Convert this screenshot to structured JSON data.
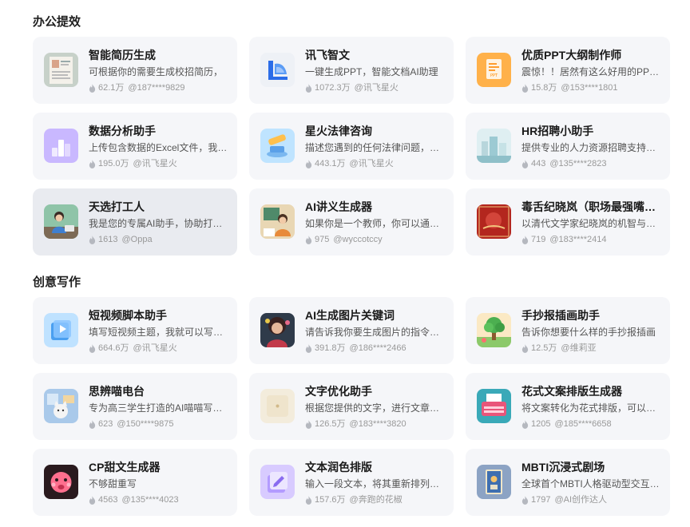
{
  "sections": [
    {
      "title": "办公提效",
      "cards": [
        {
          "name": "智能简历生成",
          "desc": "可根据你的需要生成校招简历，",
          "count": "62.1万",
          "author": "@187****9829",
          "icon": "resume-icon"
        },
        {
          "name": "讯飞智文",
          "desc": "一键生成PPT，智能文档AI助理",
          "count": "1072.3万",
          "author": "@讯飞星火",
          "icon": "zhiwen-logo-icon"
        },
        {
          "name": "优质PPT大纲制作师",
          "desc": "震惊！！居然有这么好用的PPT大纲制作师",
          "count": "15.8万",
          "author": "@153****1801",
          "icon": "ppt-icon"
        },
        {
          "name": "数据分析助手",
          "desc": "上传包含数据的Excel文件，我来帮你分析",
          "count": "195.0万",
          "author": "@讯飞星火",
          "icon": "bar-chart-icon"
        },
        {
          "name": "星火法律咨询",
          "desc": "描述您遇到的任何法律问题，我来解答",
          "count": "443.1万",
          "author": "@讯飞星火",
          "icon": "gavel-icon"
        },
        {
          "name": "HR招聘小助手",
          "desc": "提供专业的人力资源招聘支持与建议",
          "count": "443",
          "author": "@135****2823",
          "icon": "city-icon"
        },
        {
          "name": "天选打工人",
          "desc": "我是您的专属AI助手，协助打工人办公",
          "count": "1613",
          "author": "@Oppa",
          "icon": "worker-avatar-icon"
        },
        {
          "name": "AI讲义生成器",
          "desc": "如果你是一个教师，你可以通过我生成讲义",
          "count": "975",
          "author": "@wyccotccy",
          "icon": "teacher-avatar-icon"
        },
        {
          "name": "毒舌纪晓岚（职场最强嘴替）",
          "desc": "以清代文学家纪晓岚的机智与毒舌回复",
          "count": "719",
          "author": "@183****2414",
          "icon": "jixiaolan-icon"
        }
      ]
    },
    {
      "title": "创意写作",
      "cards": [
        {
          "name": "短视频脚本助手",
          "desc": "填写短视频主题，我就可以写出脚本",
          "count": "664.6万",
          "author": "@讯飞星火",
          "icon": "video-script-icon"
        },
        {
          "name": "AI生成图片关键词",
          "desc": "请告诉我你要生成图片的指令，我来优化",
          "count": "391.8万",
          "author": "@186****2466",
          "icon": "portrait-icon"
        },
        {
          "name": "手抄报插画助手",
          "desc": "告诉你想要什么样的手抄报插画",
          "count": "12.5万",
          "author": "@维莉亚",
          "icon": "tree-illustration-icon"
        },
        {
          "name": "思辨喵电台",
          "desc": "专为高三学生打造的AI喵喵写作电台",
          "count": "623",
          "author": "@150****9875",
          "icon": "cat-radio-icon"
        },
        {
          "name": "文字优化助手",
          "desc": "根据您提供的文字，进行文章优化润色",
          "count": "126.5万",
          "author": "@183****3820",
          "icon": "document-icon"
        },
        {
          "name": "花式文案排版生成器",
          "desc": "将文案转化为花式排版，可以直接使用",
          "count": "1205",
          "author": "@185****6658",
          "icon": "typewriter-icon"
        },
        {
          "name": "CP甜文生成器",
          "desc": "不够甜重写",
          "count": "4563",
          "author": "@135****4023",
          "icon": "heart-face-icon"
        },
        {
          "name": "文本润色排版",
          "desc": "输入一段文本，将其重新排列润色",
          "count": "157.6万",
          "author": "@奔跑的花椒",
          "icon": "edit-doc-icon"
        },
        {
          "name": "MBTI沉浸式剧场",
          "desc": "全球首个MBTI人格驱动型交互剧场",
          "count": "1797",
          "author": "@AI创作达人",
          "icon": "mbti-card-icon"
        }
      ]
    }
  ],
  "colors": {
    "card_bg": "#f5f6f9",
    "card_hover_bg": "#e9ebf0",
    "meta": "#999999"
  }
}
